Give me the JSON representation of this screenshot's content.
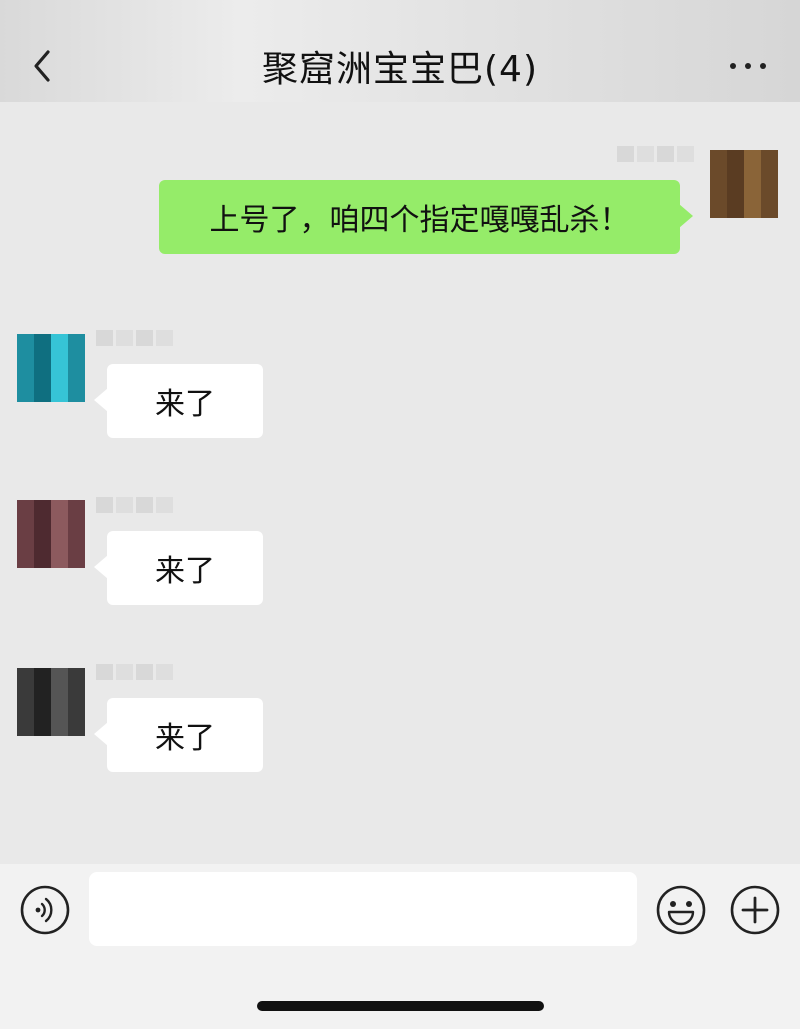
{
  "header": {
    "title": "聚窟洲宝宝巴(4)",
    "back_icon": "chevron-left-icon",
    "more_icon": "more-horizontal-icon"
  },
  "messages": [
    {
      "direction": "outgoing",
      "text": "上号了，咱四个指定嘎嘎乱杀！",
      "avatar_colors": [
        "#6b4a2a",
        "#8a6438",
        "#5a3c22"
      ]
    },
    {
      "direction": "incoming",
      "text": "来了",
      "avatar_colors": [
        "#1e8ea0",
        "#36c4d6",
        "#0f6f80"
      ]
    },
    {
      "direction": "incoming",
      "text": "来了",
      "avatar_colors": [
        "#6a3e44",
        "#8c5a5e",
        "#4e2a30"
      ]
    },
    {
      "direction": "incoming",
      "text": "来了",
      "avatar_colors": [
        "#3a3a3a",
        "#555555",
        "#222222"
      ]
    }
  ],
  "input_bar": {
    "voice_icon": "voice-icon",
    "emoji_icon": "emoji-icon",
    "plus_icon": "plus-icon",
    "input_value": ""
  },
  "colors": {
    "outgoing_bubble": "#95ec69",
    "incoming_bubble": "#ffffff",
    "chat_background": "#e9e9e9"
  }
}
